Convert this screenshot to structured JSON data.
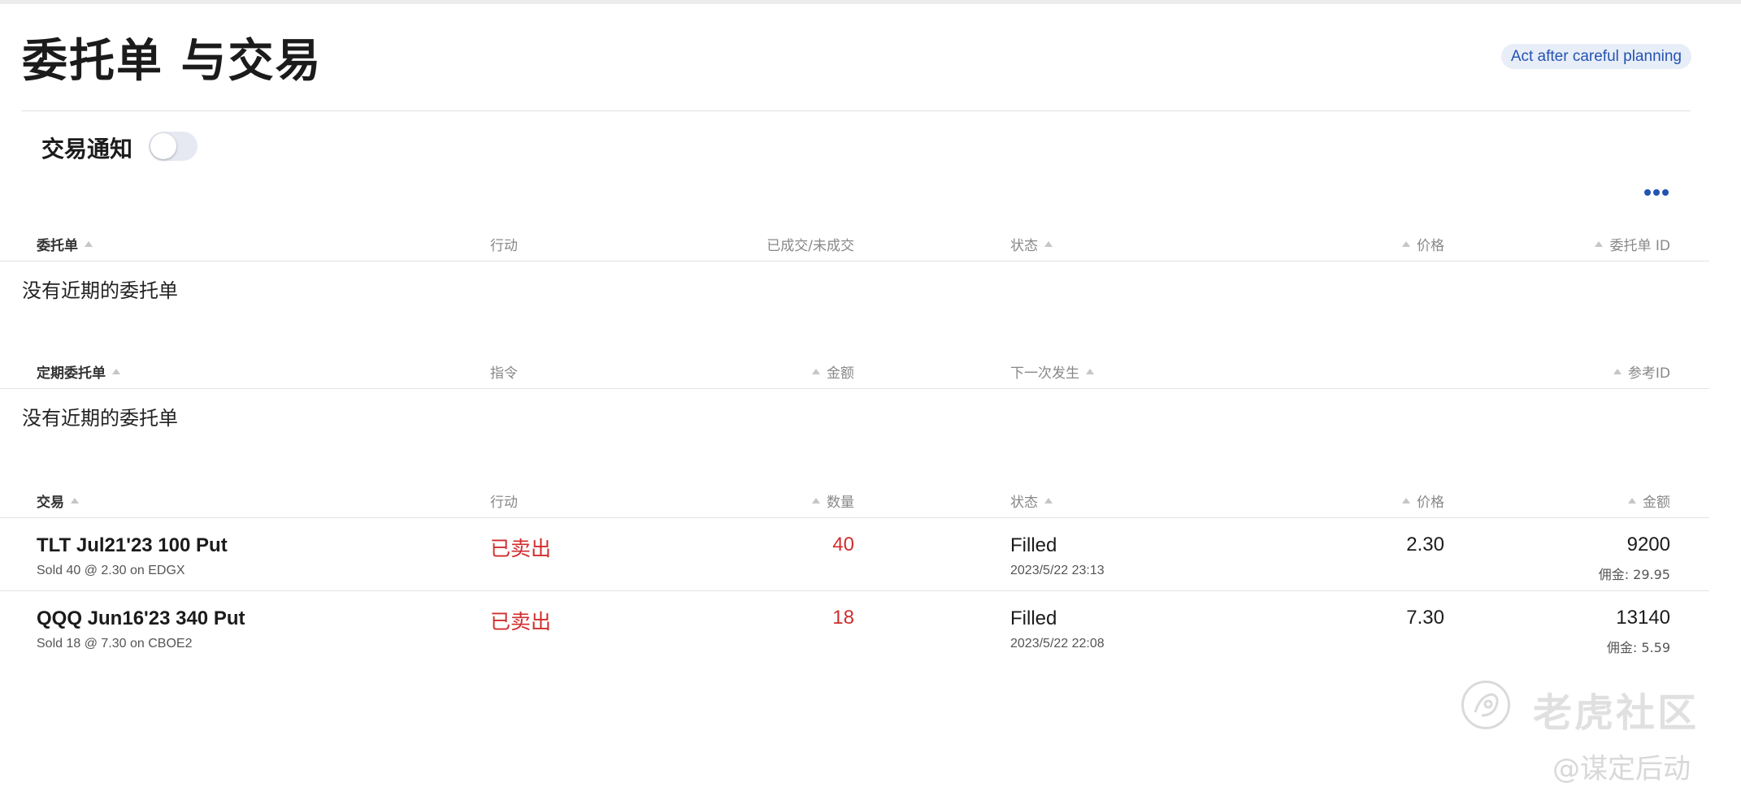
{
  "page": {
    "title": "委托单 与交易",
    "motto": "Act after careful planning"
  },
  "notifications": {
    "label": "交易通知",
    "enabled": false
  },
  "orders_table": {
    "headers": [
      "委托单",
      "行动",
      "已成交/未成交",
      "状态",
      "价格",
      "委托单 ID"
    ],
    "empty_message": "没有近期的委托单"
  },
  "recurring_table": {
    "headers": [
      "定期委托单",
      "指令",
      "金额",
      "下一次发生",
      "参考ID"
    ],
    "empty_message": "没有近期的委托单"
  },
  "trades_table": {
    "headers": [
      "交易",
      "行动",
      "数量",
      "状态",
      "价格",
      "金额"
    ],
    "rows": [
      {
        "symbol": "TLT Jul21'23 100 Put",
        "detail": "Sold 40 @ 2.30 on EDGX",
        "action": "已卖出",
        "quantity": "40",
        "status": "Filled",
        "time": "2023/5/22 23:13",
        "price": "2.30",
        "amount": "9200",
        "commission": "佣金: 29.95"
      },
      {
        "symbol": "QQQ Jun16'23 340 Put",
        "detail": "Sold 18 @ 7.30 on CBOE2",
        "action": "已卖出",
        "quantity": "18",
        "status": "Filled",
        "time": "2023/5/22 22:08",
        "price": "7.30",
        "amount": "13140",
        "commission": "佣金: 5.59"
      }
    ]
  },
  "watermark": {
    "brand": "老虎社区",
    "handle": "@谋定后动"
  },
  "colors": {
    "accent": "#2453b2",
    "sell": "#d12d2d",
    "divider": "#e2e2e2"
  }
}
